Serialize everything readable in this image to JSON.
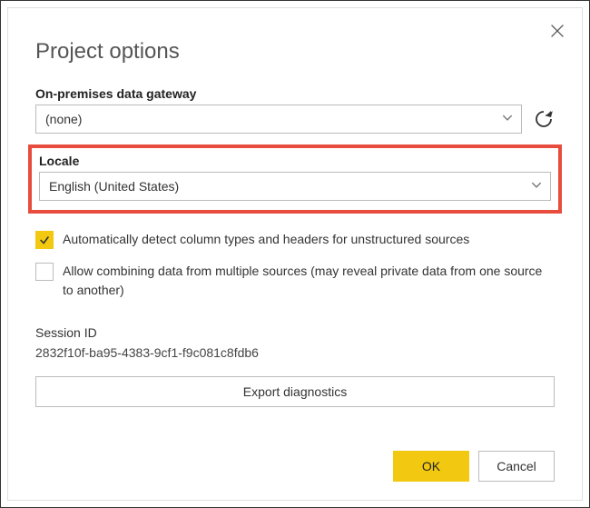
{
  "dialog": {
    "title": "Project options",
    "gateway": {
      "label": "On-premises data gateway",
      "value": "(none)"
    },
    "locale": {
      "label": "Locale",
      "value": "English (United States)"
    },
    "checkbox1": {
      "checked": true,
      "label": "Automatically detect column types and headers for unstructured sources"
    },
    "checkbox2": {
      "checked": false,
      "label": "Allow combining data from multiple sources (may reveal private data from one source to another)"
    },
    "session": {
      "label": "Session ID",
      "value": "2832f10f-ba95-4383-9cf1-f9c081c8fdb6"
    },
    "buttons": {
      "export": "Export diagnostics",
      "ok": "OK",
      "cancel": "Cancel"
    }
  }
}
